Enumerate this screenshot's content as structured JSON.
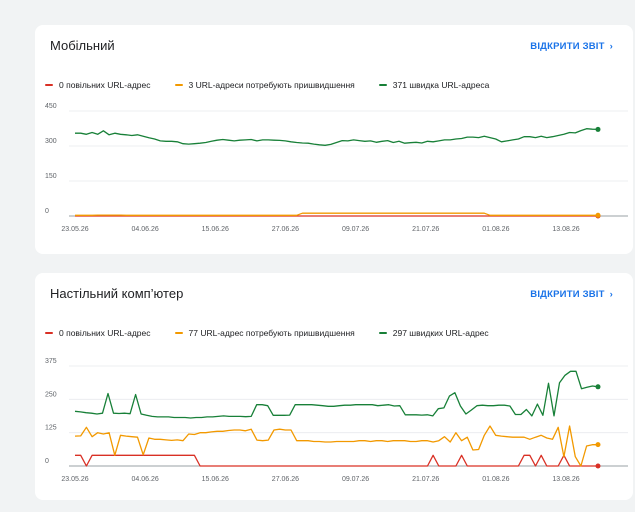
{
  "colors": {
    "slow": "#d93025",
    "needs_improvement": "#f29900",
    "fast": "#188038",
    "link": "#1a73e8",
    "grid": "#e8eaed"
  },
  "mobile": {
    "title": "Мобільний",
    "report_link": "ВІДКРИТИ ЗВІТ",
    "legend": {
      "slow": "0 повільних URL-адрес",
      "needs_improvement": "3 URL-адреси потребують пришвидшення",
      "fast": "371 швидка URL-адреса"
    }
  },
  "desktop": {
    "title": "Настільний комп’ютер",
    "report_link": "ВІДКРИТИ ЗВІТ",
    "legend": {
      "slow": "0 повільних URL-адрес",
      "needs_improvement": "77 URL-адрес потребують пришвидшення",
      "fast": "297 швидких URL-адрес"
    }
  },
  "chart_data": [
    {
      "type": "line",
      "title": "Мобільний",
      "x_tick_labels": [
        "23.05.26",
        "04.06.26",
        "15.06.26",
        "27.06.26",
        "09.07.26",
        "21.07.26",
        "01.08.26",
        "13.08.26"
      ],
      "y_ticks": [
        0,
        150,
        300,
        450
      ],
      "ylim": [
        0,
        450
      ],
      "grid": true,
      "legend_position": "top",
      "series": [
        {
          "name": "0 повільних URL-адрес",
          "color_key": "slow",
          "values": [
            0,
            0,
            0,
            0,
            0,
            0,
            0,
            0,
            0,
            0,
            0,
            0,
            0,
            0,
            0,
            0,
            0,
            0,
            0,
            0,
            0,
            0,
            0,
            0,
            0,
            0,
            0,
            0,
            0,
            0,
            0,
            0,
            0,
            0,
            0,
            0,
            0,
            0,
            0,
            0,
            0,
            0,
            0,
            0,
            0,
            0,
            0,
            0,
            0,
            0,
            0,
            0,
            0,
            0,
            0,
            0,
            0,
            0,
            0,
            0,
            0,
            0,
            0,
            0,
            0,
            0,
            0,
            0,
            0,
            0,
            0,
            0,
            0,
            0,
            0,
            0,
            0,
            0,
            0,
            0,
            0,
            0,
            0,
            0,
            0,
            0,
            0,
            0,
            0,
            0,
            0,
            0,
            0
          ]
        },
        {
          "name": "3 URL-адреси потребують пришвидшення",
          "color_key": "needs_improvement",
          "values": [
            3,
            3,
            3,
            3,
            4,
            4,
            4,
            4,
            4,
            3,
            3,
            3,
            3,
            3,
            3,
            3,
            3,
            3,
            3,
            3,
            3,
            3,
            3,
            3,
            3,
            3,
            3,
            3,
            3,
            3,
            3,
            3,
            3,
            3,
            3,
            3,
            3,
            3,
            3,
            3,
            12,
            12,
            12,
            12,
            12,
            12,
            12,
            12,
            12,
            12,
            12,
            12,
            12,
            12,
            12,
            12,
            12,
            12,
            12,
            12,
            12,
            12,
            12,
            12,
            12,
            12,
            12,
            12,
            12,
            12,
            12,
            12,
            12,
            3,
            3,
            3,
            3,
            3,
            3,
            3,
            3,
            3,
            3,
            3,
            3,
            3,
            3,
            3,
            3,
            3,
            3,
            3,
            3
          ]
        },
        {
          "name": "371 швидка URL-адреса",
          "color_key": "fast",
          "values": [
            355,
            355,
            350,
            358,
            350,
            365,
            348,
            355,
            350,
            348,
            345,
            348,
            342,
            335,
            330,
            322,
            320,
            320,
            318,
            310,
            308,
            310,
            312,
            315,
            320,
            325,
            328,
            325,
            322,
            325,
            326,
            328,
            322,
            326,
            326,
            325,
            324,
            322,
            318,
            315,
            313,
            312,
            308,
            305,
            303,
            307,
            315,
            323,
            322,
            326,
            323,
            320,
            322,
            316,
            320,
            323,
            315,
            320,
            312,
            314,
            316,
            313,
            320,
            318,
            322,
            326,
            326,
            330,
            332,
            338,
            338,
            336,
            342,
            336,
            330,
            318,
            322,
            326,
            330,
            340,
            340,
            336,
            342,
            336,
            340,
            345,
            350,
            358,
            356,
            366,
            374,
            372,
            371
          ]
        }
      ]
    },
    {
      "type": "line",
      "title": "Настільний комп’ютер",
      "x_tick_labels": [
        "23.05.26",
        "04.06.26",
        "15.06.26",
        "27.06.26",
        "09.07.26",
        "21.07.26",
        "01.08.26",
        "13.08.26"
      ],
      "y_ticks": [
        0,
        125,
        250,
        375
      ],
      "ylim": [
        0,
        375
      ],
      "grid": true,
      "legend_position": "top",
      "series": [
        {
          "name": "0 повільних URL-адрес",
          "color_key": "slow",
          "values": [
            40,
            40,
            0,
            40,
            40,
            40,
            40,
            40,
            40,
            40,
            40,
            40,
            40,
            40,
            40,
            40,
            40,
            40,
            40,
            40,
            40,
            40,
            0,
            0,
            0,
            0,
            0,
            0,
            0,
            0,
            0,
            0,
            0,
            0,
            0,
            0,
            0,
            0,
            0,
            0,
            0,
            0,
            0,
            0,
            0,
            0,
            0,
            0,
            0,
            0,
            0,
            0,
            0,
            0,
            0,
            0,
            0,
            0,
            0,
            0,
            0,
            0,
            0,
            40,
            0,
            0,
            0,
            0,
            40,
            0,
            0,
            0,
            0,
            0,
            0,
            0,
            0,
            0,
            0,
            40,
            40,
            0,
            40,
            0,
            0,
            0,
            40,
            0,
            0,
            0,
            0,
            0,
            0
          ]
        },
        {
          "name": "77 URL-адрес потребують пришвидшення",
          "color_key": "needs_improvement",
          "values": [
            112,
            113,
            145,
            110,
            125,
            120,
            125,
            40,
            115,
            112,
            110,
            108,
            42,
            105,
            100,
            100,
            98,
            96,
            98,
            95,
            120,
            118,
            125,
            125,
            128,
            130,
            130,
            133,
            135,
            135,
            132,
            138,
            97,
            95,
            97,
            135,
            138,
            135,
            135,
            95,
            95,
            95,
            92,
            92,
            90,
            90,
            92,
            92,
            92,
            92,
            95,
            95,
            92,
            95,
            95,
            92,
            95,
            95,
            95,
            92,
            92,
            95,
            95,
            90,
            95,
            110,
            90,
            125,
            95,
            108,
            60,
            62,
            115,
            150,
            115,
            112,
            110,
            108,
            108,
            108,
            100,
            108,
            115,
            105,
            100,
            145,
            35,
            150,
            35,
            0,
            75,
            80,
            80
          ]
        },
        {
          "name": "297 швидких URL-адрес",
          "color_key": "fast",
          "values": [
            205,
            203,
            200,
            198,
            195,
            198,
            272,
            198,
            197,
            198,
            196,
            268,
            195,
            190,
            186,
            184,
            184,
            184,
            182,
            182,
            182,
            180,
            182,
            182,
            184,
            184,
            186,
            188,
            186,
            186,
            186,
            185,
            186,
            230,
            230,
            226,
            190,
            190,
            190,
            191,
            230,
            230,
            230,
            230,
            228,
            226,
            224,
            224,
            226,
            228,
            228,
            230,
            230,
            230,
            230,
            226,
            228,
            230,
            225,
            226,
            192,
            192,
            192,
            191,
            192,
            188,
            215,
            218,
            262,
            275,
            225,
            195,
            210,
            226,
            228,
            226,
            226,
            228,
            228,
            225,
            193,
            193,
            212,
            188,
            232,
            190,
            310,
            188,
            312,
            340,
            355,
            355,
            290,
            295,
            300,
            297
          ]
        }
      ]
    }
  ]
}
